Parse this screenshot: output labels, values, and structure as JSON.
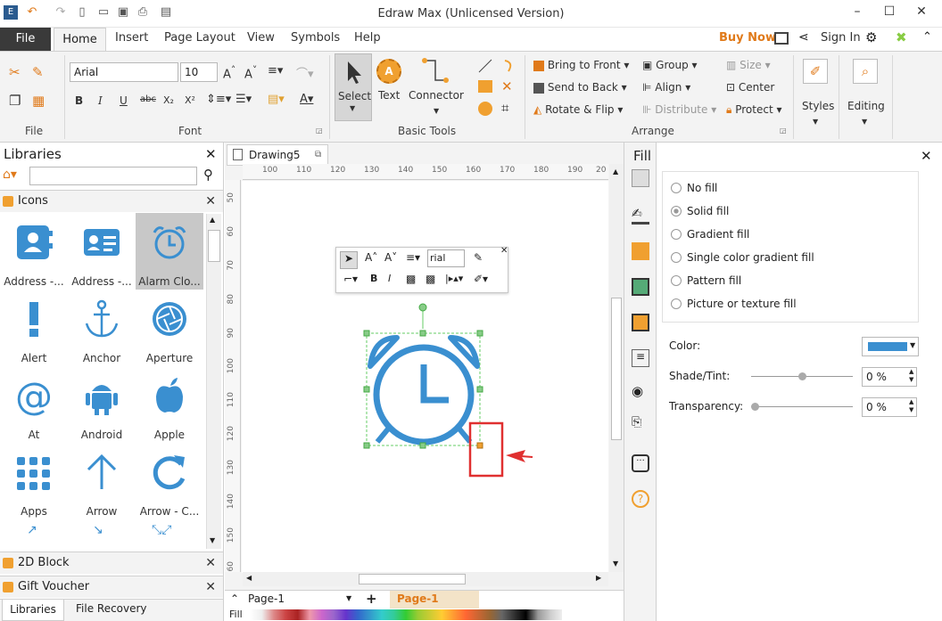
{
  "title": "Edraw Max (Unlicensed Version)",
  "menu": {
    "file": "File",
    "tabs": [
      "Home",
      "Insert",
      "Page Layout",
      "View",
      "Symbols",
      "Help"
    ],
    "buy_now": "Buy Now",
    "sign_in": "Sign In"
  },
  "ribbon": {
    "file_group": "File",
    "font_group": "Font",
    "font_name": "Arial",
    "font_size": "10",
    "basic_tools_group": "Basic Tools",
    "select": "Select",
    "text": "Text",
    "connector": "Connector",
    "arrange_group": "Arrange",
    "bring_to_front": "Bring to Front",
    "send_to_back": "Send to Back",
    "rotate_flip": "Rotate & Flip",
    "group": "Group",
    "align": "Align",
    "distribute": "Distribute",
    "size": "Size",
    "center": "Center",
    "protect": "Protect",
    "styles": "Styles",
    "editing": "Editing"
  },
  "libraries": {
    "title": "Libraries",
    "search_placeholder": "",
    "icons_header": "Icons",
    "items": [
      "Address -...",
      "Address -...",
      "Alarm Clo...",
      "Alert",
      "Anchor",
      "Aperture",
      "At",
      "Android",
      "Apple",
      "Apps",
      "Arrow",
      "Arrow - C..."
    ],
    "block2d": "2D Block",
    "gift_voucher": "Gift Voucher",
    "tab_libraries": "Libraries",
    "tab_file_recovery": "File Recovery"
  },
  "document": {
    "tab": "Drawing5",
    "hruler": [
      "100",
      "110",
      "120",
      "130",
      "140",
      "150",
      "160",
      "170",
      "180",
      "190",
      "20"
    ],
    "vruler": [
      "50",
      "60",
      "70",
      "80",
      "90",
      "100",
      "110",
      "120",
      "130",
      "140",
      "150",
      "160"
    ],
    "float_font": "rial",
    "page_select": "Page-1",
    "page_tab": "Page-1",
    "fill_label": "Fill"
  },
  "fill": {
    "title": "Fill",
    "options": [
      "No fill",
      "Solid fill",
      "Gradient fill",
      "Single color gradient fill",
      "Pattern fill",
      "Picture or texture fill"
    ],
    "selected": "Solid fill",
    "color_label": "Color:",
    "shade_label": "Shade/Tint:",
    "shade_value": "0 %",
    "transparency_label": "Transparency:",
    "transparency_value": "0 %",
    "color": "#3a8fd0"
  },
  "colors": {
    "icon_blue": "#3a8fd0",
    "accent_orange": "#f0a030",
    "highlight_red": "#e03030"
  }
}
